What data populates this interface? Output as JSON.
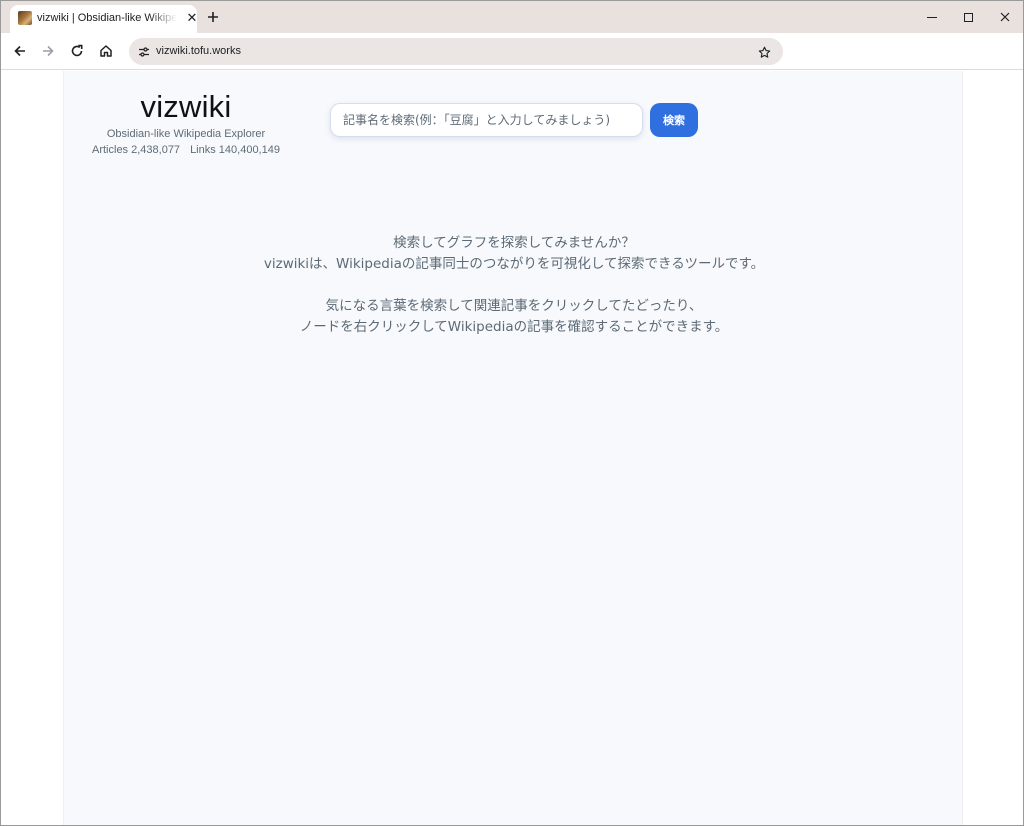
{
  "browser": {
    "tab_title": "vizwiki | Obsidian-like Wikipedia Explorer",
    "url": "vizwiki.tofu.works",
    "icons": {
      "tab_close": "close-icon",
      "new_tab": "plus-icon",
      "back": "arrow-left-icon",
      "forward": "arrow-right-icon",
      "reload": "reload-icon",
      "home": "home-icon",
      "site_info": "site-settings-icon",
      "bookmark": "star-icon",
      "minimize": "minimize-icon",
      "maximize": "maximize-icon",
      "close": "close-icon"
    }
  },
  "header": {
    "logo": "vizwiki",
    "tagline": "Obsidian-like Wikipedia Explorer",
    "articles_stat": "Articles 2,438,077",
    "links_stat": "Links 140,400,149"
  },
  "search": {
    "placeholder": "記事名を検索(例：「豆腐」と入力してみましょう)",
    "button_label": "検索"
  },
  "intro": {
    "line1": "検索してグラフを探索してみませんか？",
    "line2": "vizwikiは、Wikipediaの記事同士のつながりを可視化して探索できるツールです。",
    "line3": "気になる言葉を検索して関連記事をクリックしてたどったり、",
    "line4": "ノードを右クリックしてWikipediaの記事を確認することができます。"
  },
  "colors": {
    "accent": "#2f6fe0",
    "page_background": "#f7f9fc",
    "muted_text": "#5d6a76",
    "tab_strip": "#e8e1de"
  }
}
